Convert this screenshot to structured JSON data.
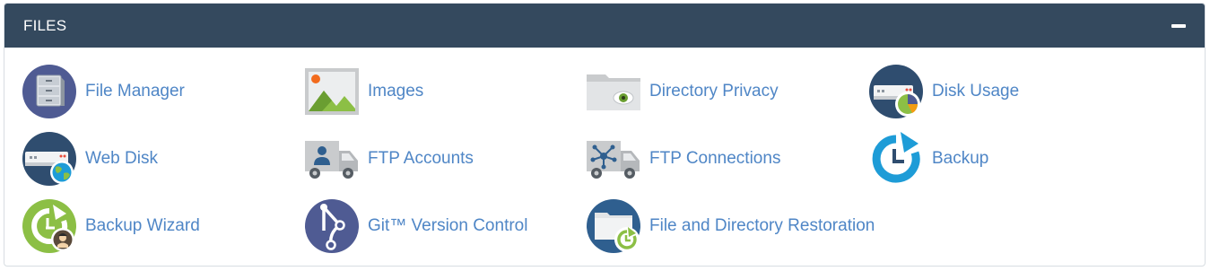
{
  "panel": {
    "title": "FILES",
    "collapse_icon": "minus-icon"
  },
  "colors": {
    "header_bg": "#34495e",
    "link": "#4f86c6",
    "navy_circle": "#4f5b93",
    "green": "#8cbf45",
    "blue": "#1e9cd7"
  },
  "items": [
    {
      "label": "File Manager",
      "icon": "file-cabinet-icon"
    },
    {
      "label": "Images",
      "icon": "image-icon"
    },
    {
      "label": "Directory Privacy",
      "icon": "folder-eye-icon"
    },
    {
      "label": "Disk Usage",
      "icon": "disk-pie-icon"
    },
    {
      "label": "Web Disk",
      "icon": "server-globe-icon"
    },
    {
      "label": "FTP Accounts",
      "icon": "truck-user-icon"
    },
    {
      "label": "FTP Connections",
      "icon": "truck-network-icon"
    },
    {
      "label": "Backup",
      "icon": "backup-clock-icon"
    },
    {
      "label": "Backup Wizard",
      "icon": "backup-wizard-icon"
    },
    {
      "label": "Git™ Version Control",
      "icon": "git-branch-icon"
    },
    {
      "label": "File and Directory Restoration",
      "icon": "folder-restore-icon"
    }
  ]
}
